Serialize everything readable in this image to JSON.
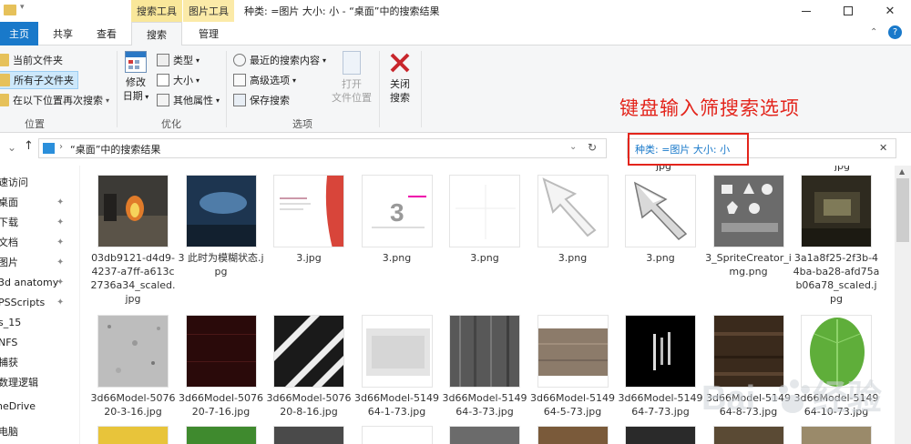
{
  "window": {
    "context_tabs": [
      "搜索工具",
      "图片工具"
    ],
    "title": "种类: =图片 大小: 小 - “桌面”中的搜索结果"
  },
  "ribbon": {
    "tabs": [
      "主页",
      "共享",
      "查看",
      "搜索",
      "管理"
    ],
    "active_tab": "搜索",
    "location": {
      "items": [
        "当前文件夹",
        "所有子文件夹",
        "在以下位置再次搜索"
      ],
      "label": "位置"
    },
    "refine": {
      "date_btn": [
        "修改",
        "日期"
      ],
      "items": [
        "类型",
        "大小",
        "其他属性"
      ],
      "label": "优化"
    },
    "options": {
      "items": [
        "最近的搜索内容",
        "高级选项",
        "保存搜索"
      ],
      "open_btn": [
        "打开",
        "文件位置"
      ],
      "label": "选项"
    },
    "close_btn": [
      "关闭",
      "搜索"
    ]
  },
  "address": {
    "path": "“桌面”中的搜索结果",
    "search_value": "种类: =图片 大小: 小"
  },
  "annotation": "键盘输入筛搜索选项",
  "nav": {
    "items": [
      {
        "label": "速访问",
        "pin": false
      },
      {
        "label": "桌面",
        "pin": true
      },
      {
        "label": "下载",
        "pin": true
      },
      {
        "label": "文档",
        "pin": true
      },
      {
        "label": "图片",
        "pin": true
      },
      {
        "label": "3d anatomy",
        "pin": true
      },
      {
        "label": "PSScripts",
        "pin": true
      },
      {
        "label": "s_15",
        "pin": false
      },
      {
        "label": "NFS",
        "pin": false
      },
      {
        "label": "捕获",
        "pin": false
      },
      {
        "label": "数理逻辑",
        "pin": false
      },
      {
        "label": "neDrive",
        "pin": false
      },
      {
        "label": "电脑",
        "pin": false
      }
    ]
  },
  "files": {
    "row1": [
      {
        "name": "03db9121-d4d9-4237-a7ff-a613c2736a34_scaled.jpg",
        "thumb": "fire-scene"
      },
      {
        "name": "3 此时为模糊状态.jpg",
        "thumb": "dark-blue-scene"
      },
      {
        "name": "3.jpg",
        "thumb": "document-red"
      },
      {
        "name": "3.png",
        "thumb": "slide-3"
      },
      {
        "name": "3.png",
        "thumb": "blank-grid"
      },
      {
        "name": "3.png",
        "thumb": "cursor-outline"
      },
      {
        "name": "3.png",
        "thumb": "cursor-filled"
      },
      {
        "name": "3_SpriteCreator_img.png",
        "thumb": "shapes-gray"
      },
      {
        "name": "3a1a8f25-2f3b-44ba-ba28-afd75ab06a78_scaled.jpg",
        "thumb": "dark-room"
      }
    ],
    "row2": [
      {
        "name": "3d66Model-507620-3-16.jpg",
        "thumb": "granite"
      },
      {
        "name": "3d66Model-507620-7-16.jpg",
        "thumb": "dark-red"
      },
      {
        "name": "3d66Model-507620-8-16.jpg",
        "thumb": "stripes"
      },
      {
        "name": "3d66Model-514964-1-73.jpg",
        "thumb": "white-texture"
      },
      {
        "name": "3d66Model-514964-3-73.jpg",
        "thumb": "wood-gray"
      },
      {
        "name": "3d66Model-514964-5-73.jpg",
        "thumb": "wood-brown"
      },
      {
        "name": "3d66Model-514964-7-73.jpg",
        "thumb": "black-text"
      },
      {
        "name": "3d66Model-514964-8-73.jpg",
        "thumb": "wood-dark"
      },
      {
        "name": "3d66Model-514964-10-73.jpg",
        "thumb": "leaf"
      }
    ],
    "row0_partial": [
      "jpg",
      "jpg"
    ]
  },
  "colors": {
    "accent": "#1979ca",
    "context_tab": "#f9e79a",
    "annotation": "#e3241b"
  }
}
